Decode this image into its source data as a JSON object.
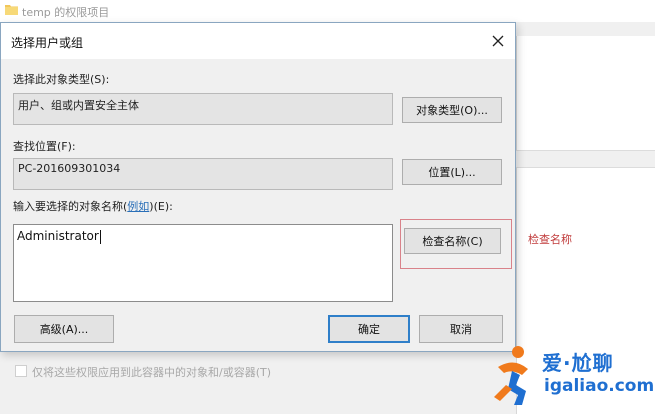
{
  "background_window": {
    "title": "temp 的权限项目",
    "checkbox_label": "仅将这些权限应用到此容器中的对象和/或容器(T)"
  },
  "dialog": {
    "title": "选择用户或组",
    "object_type": {
      "label": "选择此对象类型(S):",
      "value": "用户、组或内置安全主体",
      "button": "对象类型(O)..."
    },
    "location": {
      "label": "查找位置(F):",
      "value": "PC-201609301034",
      "button": "位置(L)..."
    },
    "names": {
      "label_prefix": "输入要选择的对象名称(",
      "label_link": "例如",
      "label_suffix": ")(E):",
      "value": "Administrator",
      "check_button": "检查名称(C)"
    },
    "buttons": {
      "advanced": "高级(A)...",
      "ok": "确定",
      "cancel": "取消"
    }
  },
  "annotation": {
    "text": "检查名称",
    "color": "#c03a3a"
  },
  "watermark": {
    "line1": "爱·尬聊",
    "line2": "igaliao.com",
    "color": "#1f6fd1"
  },
  "colors": {
    "accent": "#2f7fc9",
    "highlight": "#d9828a"
  },
  "icons": {
    "folder": "folder-icon",
    "close": "close-icon",
    "watermark_logo": "runner-logo-icon"
  }
}
